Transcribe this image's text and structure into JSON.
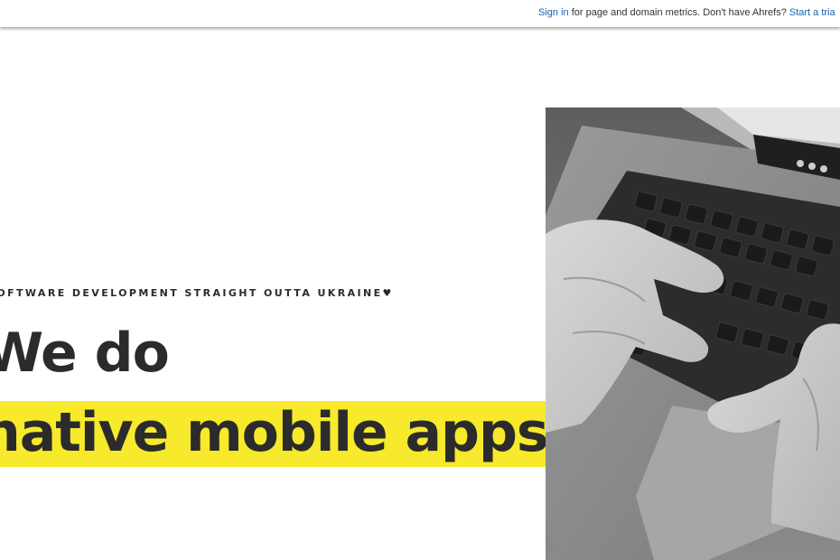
{
  "ahrefs_bar": {
    "sign_in_link": "Sign in",
    "message": " for page and domain metrics. Don't have Ahrefs? ",
    "trial_link": "Start a tria"
  },
  "hero": {
    "tagline": "SOFTWARE DEVELOPMENT STRAIGHT OUTTA UKRAINE♥",
    "headline_line1": "We do",
    "headline_line2": "native mobile apps",
    "highlight_color": "#f7e92b",
    "image_description_icon": "laptop-typing-photo"
  }
}
